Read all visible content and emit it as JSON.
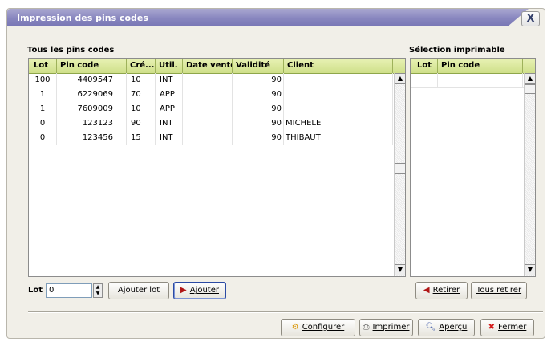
{
  "window": {
    "title": "Impression des pins codes",
    "close_label": "X"
  },
  "left_panel": {
    "label": "Tous les pins codes",
    "columns": [
      "Lot",
      "Pin code",
      "Cré...",
      "Util.",
      "Date vente",
      "Validité",
      "Client"
    ],
    "rows": [
      [
        "100",
        "4409547",
        "10",
        "INT",
        "",
        "90",
        ""
      ],
      [
        "1",
        "6229069",
        "70",
        "APP",
        "",
        "90",
        ""
      ],
      [
        "1",
        "7609009",
        "10",
        "APP",
        "",
        "90",
        ""
      ],
      [
        "0",
        "123123",
        "90",
        "INT",
        "",
        "90",
        "MICHELE"
      ],
      [
        "0",
        "123456",
        "15",
        "INT",
        "",
        "90",
        "THIBAUT"
      ]
    ]
  },
  "right_panel": {
    "label": "Sélection imprimable",
    "columns": [
      "Lot",
      "Pin code"
    ]
  },
  "lot": {
    "label": "Lot",
    "value": "0"
  },
  "buttons": {
    "ajouter_lot": "Ajouter lot",
    "ajouter": "Ajouter",
    "retirer": "Retirer",
    "tous_retirer": "Tous retirer",
    "configurer": "Configurer",
    "imprimer": "Imprimer",
    "apercu": "Aperçu",
    "fermer": "Fermer"
  },
  "icons": {
    "add_arrow": "right-triangle",
    "remove_arrow": "left-triangle",
    "configure": "gear",
    "print": "printer",
    "preview": "magnifier",
    "close": "red-x"
  }
}
